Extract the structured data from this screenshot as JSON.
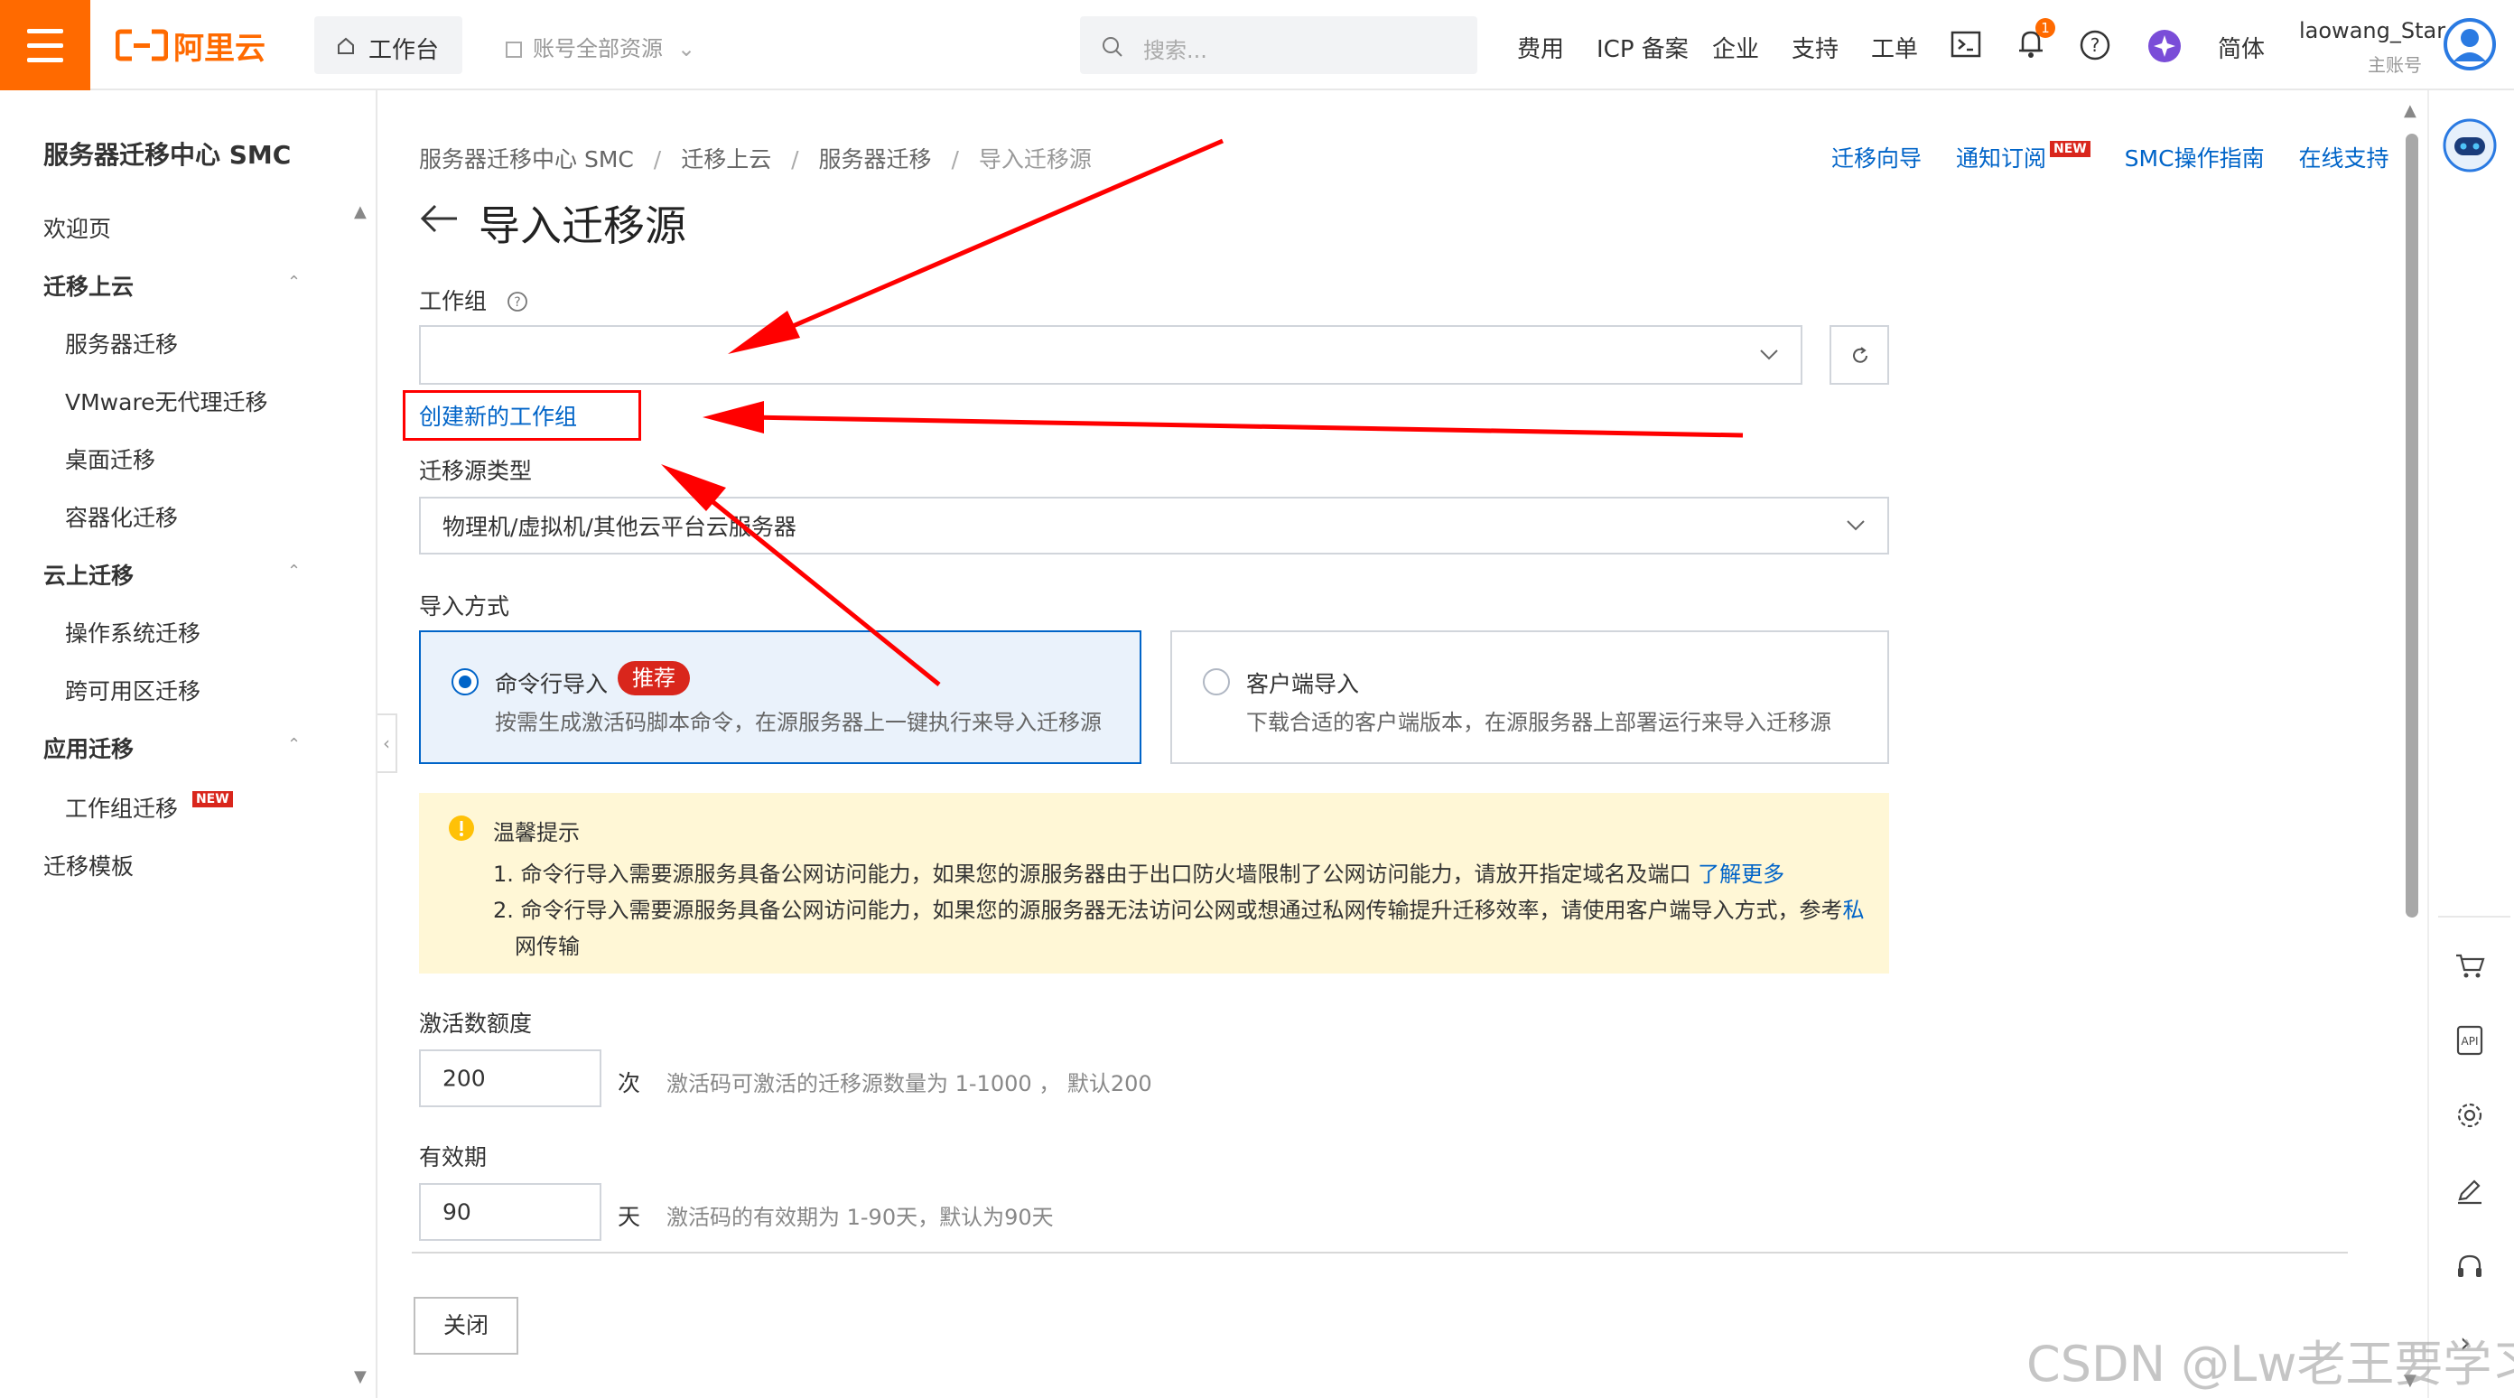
{
  "header": {
    "logo_text": "阿里云",
    "workbench": "工作台",
    "resource_scope": "账号全部资源",
    "search_placeholder": "搜索...",
    "nav": [
      "费用",
      "ICP 备案",
      "企业",
      "支持",
      "工单"
    ],
    "notification_count": "1",
    "language": "简体",
    "username": "laowang_Star",
    "account_type": "主账号"
  },
  "sidebar": {
    "title": "服务器迁移中心 SMC",
    "welcome": "欢迎页",
    "groups": [
      {
        "label": "迁移上云",
        "items": [
          "服务器迁移",
          "VMware无代理迁移",
          "桌面迁移",
          "容器化迁移"
        ]
      },
      {
        "label": "云上迁移",
        "items": [
          "操作系统迁移",
          "跨可用区迁移"
        ]
      },
      {
        "label": "应用迁移",
        "items": [
          "工作组迁移"
        ]
      }
    ],
    "new_badge": "NEW",
    "template": "迁移模板"
  },
  "breadcrumb": [
    "服务器迁移中心 SMC",
    "迁移上云",
    "服务器迁移",
    "导入迁移源"
  ],
  "top_links": {
    "guide": "迁移向导",
    "subscribe": "通知订阅",
    "subscribe_badge": "NEW",
    "manual": "SMC操作指南",
    "support": "在线支持"
  },
  "page_title": "导入迁移源",
  "form": {
    "workgroup_label": "工作组",
    "workgroup_value": "",
    "create_workgroup_link": "创建新的工作组",
    "source_type_label": "迁移源类型",
    "source_type_value": "物理机/虚拟机/其他云平台云服务器",
    "import_method_label": "导入方式",
    "methods": [
      {
        "title": "命令行导入",
        "badge": "推荐",
        "desc": "按需生成激活码脚本命令，在源服务器上一键执行来导入迁移源",
        "selected": true
      },
      {
        "title": "客户端导入",
        "desc": "下载合适的客户端版本，在源服务器上部署运行来导入迁移源",
        "selected": false
      }
    ],
    "notice": {
      "title": "温馨提示",
      "line1": "1. 命令行导入需要源服务具备公网访问能力，如果您的源服务器由于出口防火墙限制了公网访问能力，请放开指定域名及端口",
      "line1_link": "了解更多",
      "line2": "2. 命令行导入需要源服务具备公网访问能力，如果您的源服务器无法访问公网或想通过私网传输提升迁移效率，请使用客户端导入方式，参考",
      "line2_link_a": "私",
      "line2_link_b": "网传输"
    },
    "quota_label": "激活数额度",
    "quota_value": "200",
    "quota_unit": "次",
    "quota_hint": "激活码可激活的迁移源数量为 1-1000 ， 默认200",
    "validity_label": "有效期",
    "validity_value": "90",
    "validity_unit": "天",
    "validity_hint": "激活码的有效期为 1-90天，默认为90天",
    "close_button": "关闭"
  },
  "watermark": "CSDN @Lw老王要学习",
  "colors": {
    "brand": "#ff6a00",
    "link": "#0064c8",
    "annotation": "#ff0000",
    "badge": "#d9261c",
    "notice_bg": "#fff7d6"
  }
}
